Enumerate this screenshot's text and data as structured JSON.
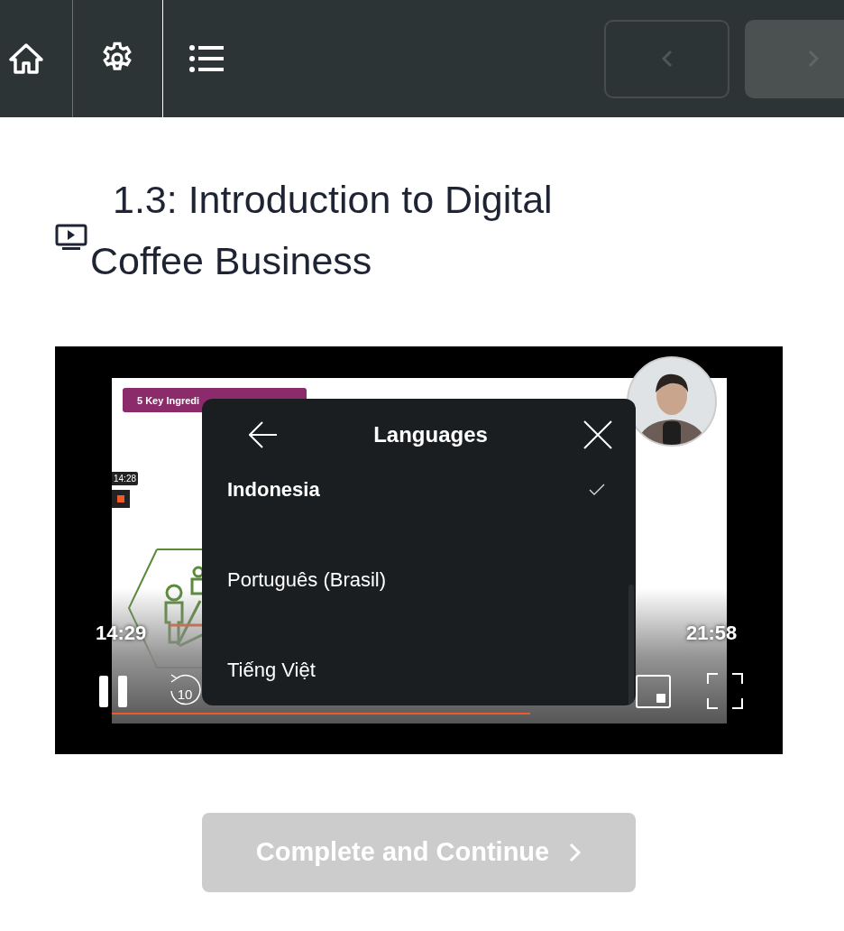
{
  "lesson": {
    "title": "1.3: Introduction to Digital Coffee Business"
  },
  "video": {
    "slide": {
      "banner": "5 Key Ingredi",
      "timer": "14:28"
    },
    "progress": {
      "level": 0.68
    },
    "elapsed": "14:29",
    "duration": "21:58",
    "rewind": "10",
    "languages_menu": {
      "title": "Languages",
      "items": [
        {
          "label": "Indonesia",
          "selected": true
        },
        {
          "label": "Português (Brasil)",
          "selected": false
        },
        {
          "label": "Tiếng Việt",
          "selected": false
        }
      ]
    }
  },
  "complete_button": {
    "label": "Complete and Continue",
    "disabled": true
  }
}
